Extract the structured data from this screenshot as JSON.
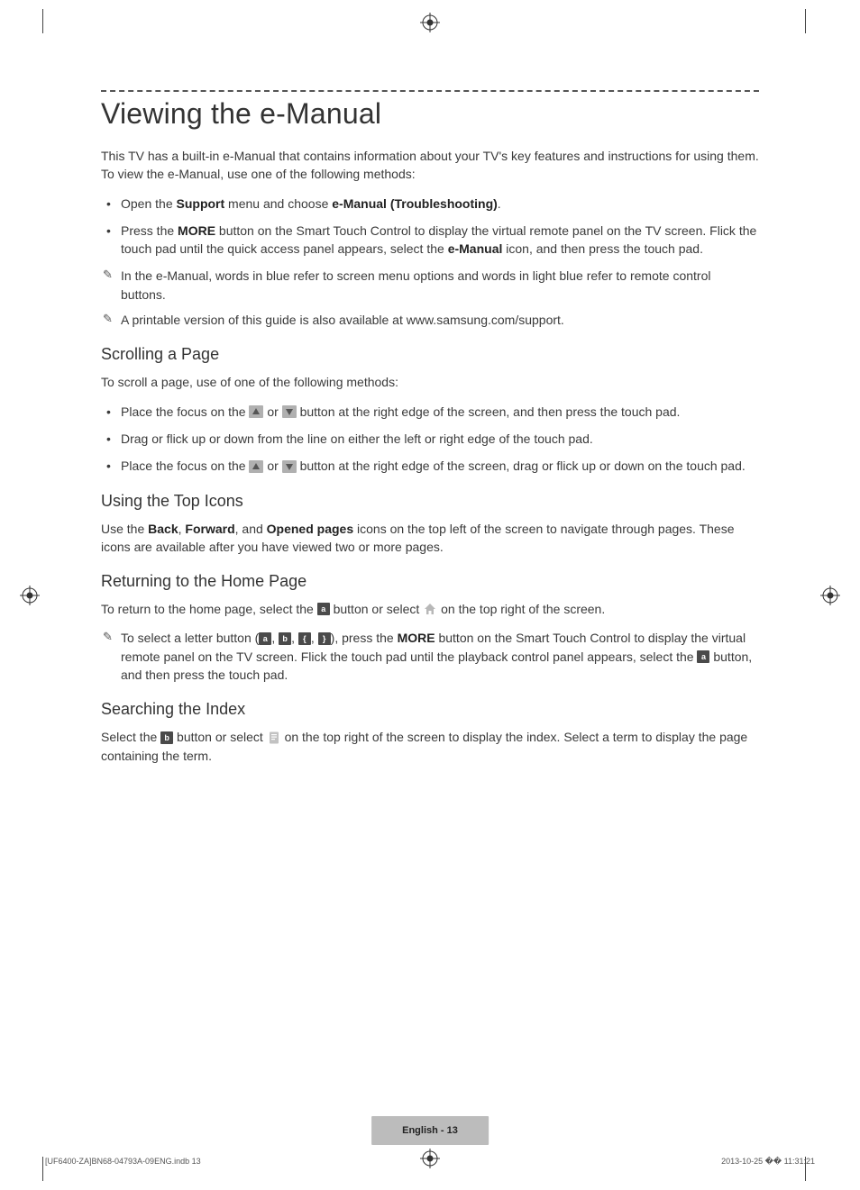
{
  "title": "Viewing the e-Manual",
  "intro": "This TV has a built-in e-Manual that contains information about your TV's key features and instructions for using them. To view the e-Manual, use one of the following methods:",
  "bullets1": {
    "b1_pre": "Open the ",
    "b1_bold1": "Support",
    "b1_mid": " menu and choose ",
    "b1_bold2": "e-Manual (Troubleshooting)",
    "b1_post": ".",
    "b2_pre": "Press the ",
    "b2_bold1": "MORE",
    "b2_mid": " button on the Smart Touch Control to display the virtual remote panel on the TV screen. Flick the touch pad until the quick access panel appears, select the ",
    "b2_bold2": "e-Manual",
    "b2_post": " icon, and then press the touch pad."
  },
  "notes1": {
    "n1": "In the e-Manual, words in blue refer to screen menu options and words in light blue refer to remote control buttons.",
    "n2": "A printable version of this guide is also available at www.samsung.com/support."
  },
  "section_scroll": {
    "heading": "Scrolling a Page",
    "intro": "To scroll a page, use of one of the following methods:",
    "b1_pre": "Place the focus on the ",
    "b1_mid": " or ",
    "b1_post": " button at the right edge of the screen, and then press the touch pad.",
    "b2": "Drag or flick up or down from the line on either the left or right edge of the touch pad.",
    "b3_pre": "Place the focus on the ",
    "b3_mid": " or ",
    "b3_post": " button at the right edge of the screen, drag or flick up or down on the touch pad."
  },
  "section_top": {
    "heading": "Using the Top Icons",
    "p_pre": "Use the ",
    "p_b1": "Back",
    "p_c1": ", ",
    "p_b2": "Forward",
    "p_c2": ", and ",
    "p_b3": "Opened pages",
    "p_post": " icons on the top left of the screen to navigate through pages. These icons are available after you have viewed two or more pages."
  },
  "section_home": {
    "heading": "Returning to the Home Page",
    "p_pre": "To return to the home page, select the ",
    "p_mid": " button or select ",
    "p_post": " on the top right of the screen.",
    "note_pre": "To select a letter button (",
    "note_c": ", ",
    "note_mid1": "), press the ",
    "note_bold": "MORE",
    "note_mid2": " button on the Smart Touch Control to display the virtual remote panel on the TV screen. Flick the touch pad until the playback control panel appears, select the ",
    "note_post": " button, and then press the touch pad."
  },
  "section_index": {
    "heading": "Searching the Index",
    "p_pre": "Select the ",
    "p_mid": " button or select ",
    "p_post": " on the top right of the screen to display the index. Select a term to display the page containing the term."
  },
  "letters": {
    "a": "a",
    "b": "b",
    "c": "{",
    "d": "}"
  },
  "footer_box": "English - 13",
  "print_left": "[UF6400-ZA]BN68-04793A-09ENG.indb   13",
  "print_right": "2013-10-25   �� 11:31:21"
}
